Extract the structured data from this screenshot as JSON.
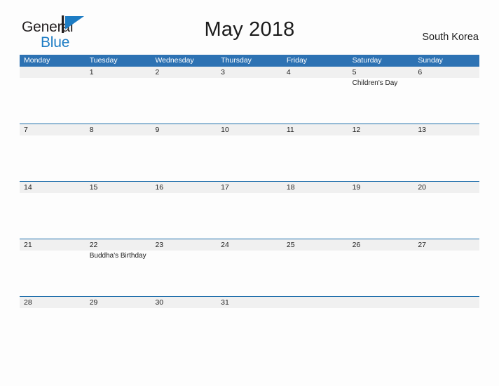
{
  "brand": {
    "line1": "General",
    "line2": "Blue",
    "flag_icon": "blue-flag-icon",
    "text_color": "#231f20",
    "accent_color": "#1d7cc4"
  },
  "header": {
    "title": "May 2018",
    "region": "South Korea"
  },
  "theme": {
    "header_blue": "#2d72b3",
    "separator_blue": "#1f6eab",
    "date_band_gray": "#f0f0f0",
    "page_background": "#fdfdfd"
  },
  "calendar": {
    "weekdays": [
      "Monday",
      "Tuesday",
      "Wednesday",
      "Thursday",
      "Friday",
      "Saturday",
      "Sunday"
    ],
    "weeks": [
      [
        {
          "date": "",
          "events": []
        },
        {
          "date": "1",
          "events": []
        },
        {
          "date": "2",
          "events": []
        },
        {
          "date": "3",
          "events": []
        },
        {
          "date": "4",
          "events": []
        },
        {
          "date": "5",
          "events": [
            "Children's Day"
          ]
        },
        {
          "date": "6",
          "events": []
        }
      ],
      [
        {
          "date": "7",
          "events": []
        },
        {
          "date": "8",
          "events": []
        },
        {
          "date": "9",
          "events": []
        },
        {
          "date": "10",
          "events": []
        },
        {
          "date": "11",
          "events": []
        },
        {
          "date": "12",
          "events": []
        },
        {
          "date": "13",
          "events": []
        }
      ],
      [
        {
          "date": "14",
          "events": []
        },
        {
          "date": "15",
          "events": []
        },
        {
          "date": "16",
          "events": []
        },
        {
          "date": "17",
          "events": []
        },
        {
          "date": "18",
          "events": []
        },
        {
          "date": "19",
          "events": []
        },
        {
          "date": "20",
          "events": []
        }
      ],
      [
        {
          "date": "21",
          "events": []
        },
        {
          "date": "22",
          "events": [
            "Buddha's Birthday"
          ]
        },
        {
          "date": "23",
          "events": []
        },
        {
          "date": "24",
          "events": []
        },
        {
          "date": "25",
          "events": []
        },
        {
          "date": "26",
          "events": []
        },
        {
          "date": "27",
          "events": []
        }
      ],
      [
        {
          "date": "28",
          "events": []
        },
        {
          "date": "29",
          "events": []
        },
        {
          "date": "30",
          "events": []
        },
        {
          "date": "31",
          "events": []
        },
        {
          "date": "",
          "events": []
        },
        {
          "date": "",
          "events": []
        },
        {
          "date": "",
          "events": []
        }
      ]
    ]
  }
}
